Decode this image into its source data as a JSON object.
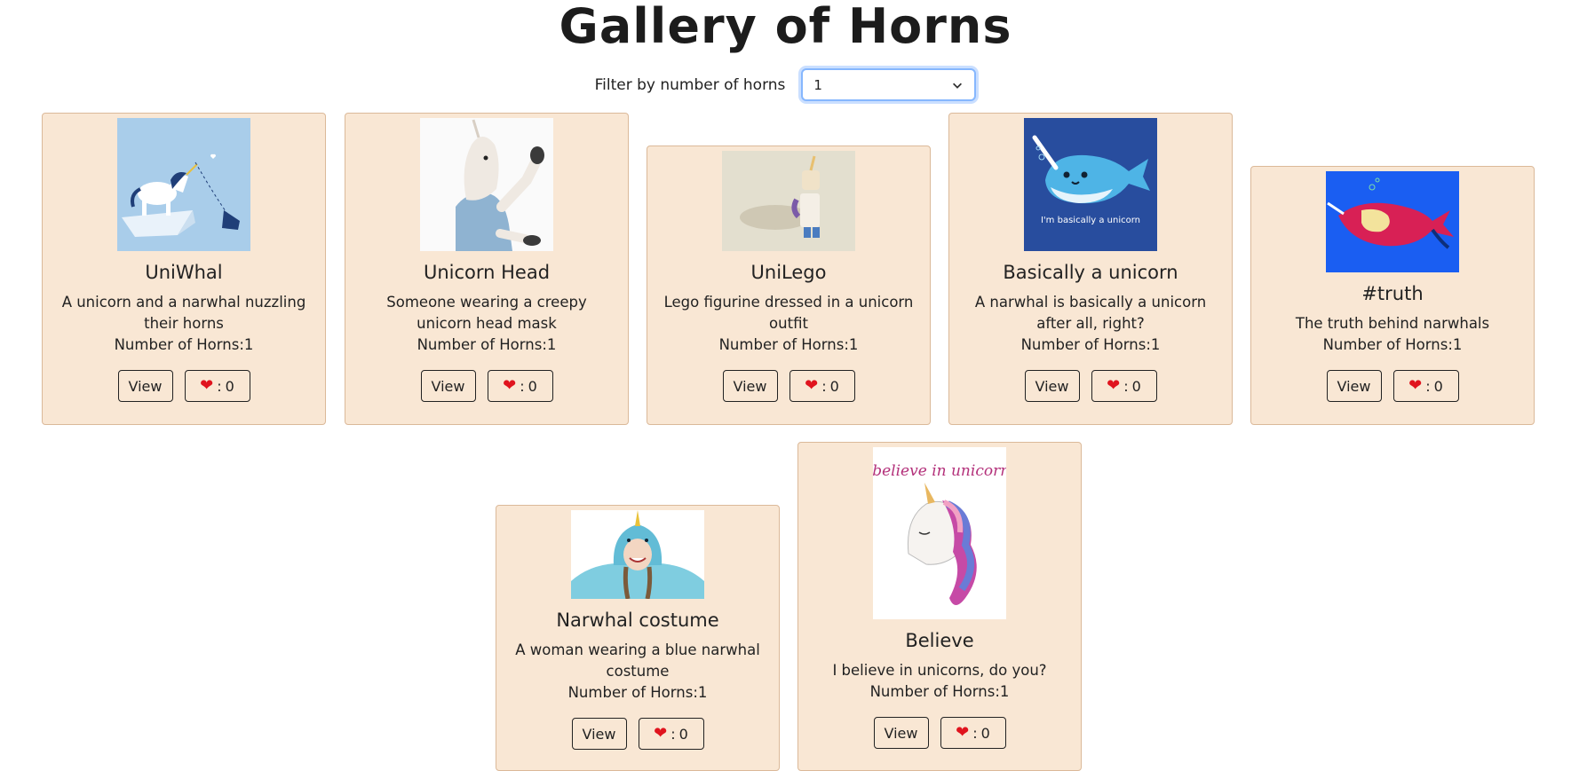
{
  "page": {
    "title": "Gallery of Horns"
  },
  "filter": {
    "label": "Filter by number of horns",
    "selected": "1"
  },
  "card_common": {
    "horns_prefix": "Number of Horns:",
    "view_label": "View",
    "like_sep": ": "
  },
  "cards": [
    {
      "title": "UniWhal",
      "description": "A unicorn and a narwhal nuzzling their horns",
      "horns": "1",
      "likes": "0",
      "image_icon": "unicorn-narwhal-image"
    },
    {
      "title": "Unicorn Head",
      "description": "Someone wearing a creepy unicorn head mask",
      "horns": "1",
      "likes": "0",
      "image_icon": "unicorn-mask-image"
    },
    {
      "title": "UniLego",
      "description": "Lego figurine dressed in a unicorn outfit",
      "horns": "1",
      "likes": "0",
      "image_icon": "lego-figure-image"
    },
    {
      "title": "Basically a unicorn",
      "description": "A narwhal is basically a unicorn after all, right?",
      "horns": "1",
      "likes": "0",
      "image_icon": "narwhal-image",
      "image_text": "I'm basically a unicorn"
    },
    {
      "title": "#truth",
      "description": "The truth behind narwhals",
      "horns": "1",
      "likes": "0",
      "image_icon": "narwhal-truth-image"
    },
    {
      "title": "Narwhal costume",
      "description": "A woman wearing a blue narwhal costume",
      "horns": "1",
      "likes": "0",
      "image_icon": "narwhal-costume-image"
    },
    {
      "title": "Believe",
      "description": "I believe in unicorns, do you?",
      "horns": "1",
      "likes": "0",
      "image_icon": "unicorn-believe-image",
      "image_text": "I believe in unicorns"
    }
  ],
  "colors": {
    "card_bg": "#f9e7d4",
    "card_border": "#dbb999",
    "heart": "#e0141e",
    "select_focus": "#86b7fe"
  }
}
